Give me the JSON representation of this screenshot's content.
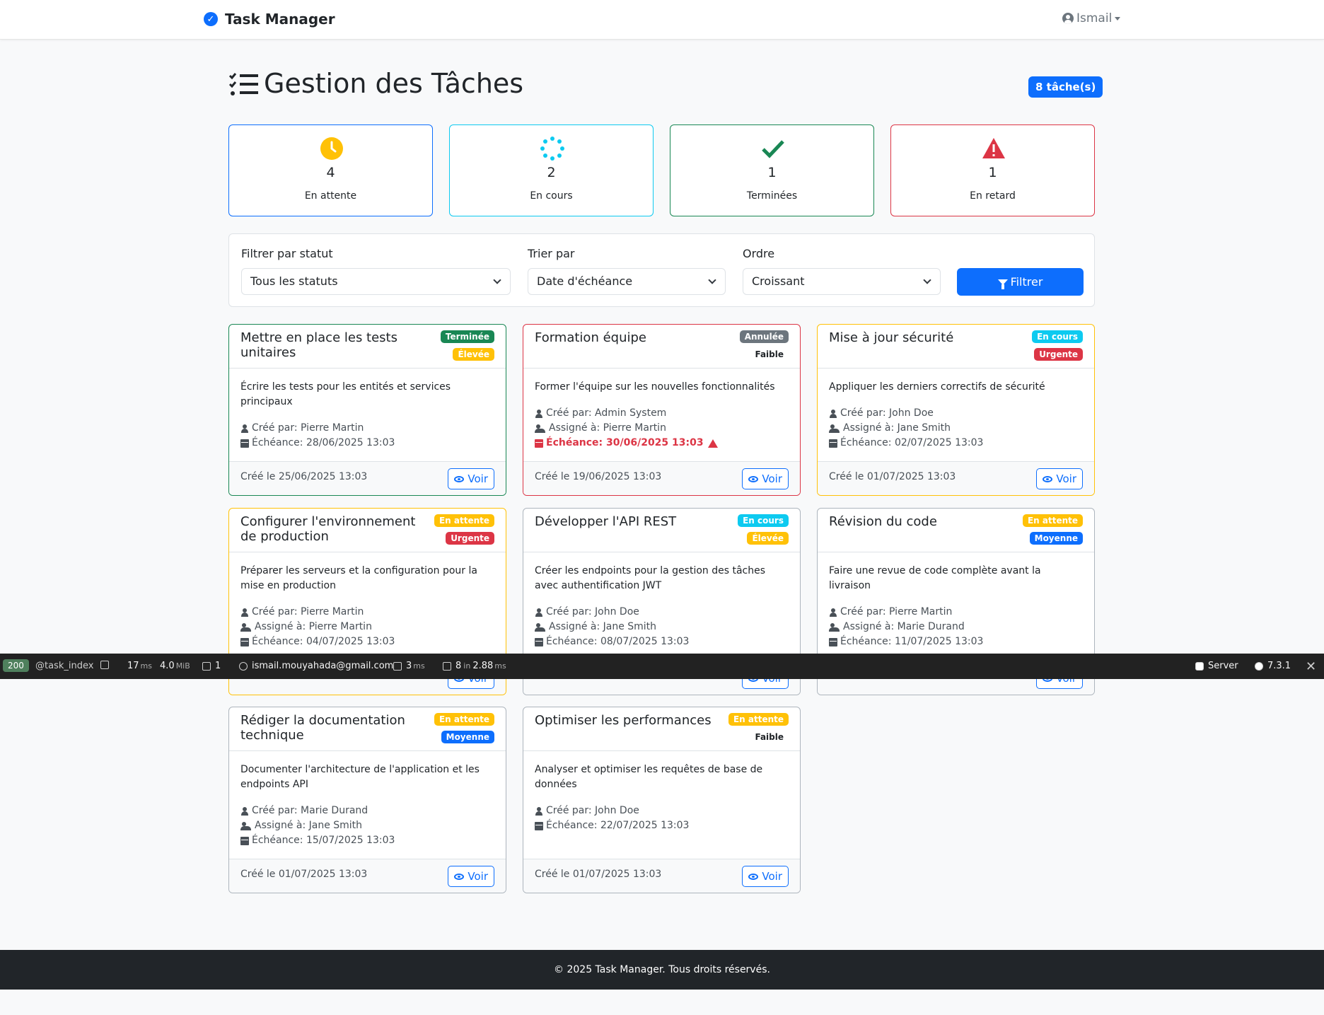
{
  "navbar": {
    "brand": "Task Manager",
    "user": "Ismail"
  },
  "header": {
    "title": "Gestion des Tâches",
    "count_badge": "8 tâche(s)"
  },
  "stats": [
    {
      "value": "4",
      "label": "En attente",
      "color": "#0d6efd",
      "icon": "clock-icon",
      "icon_color": "#ffc107"
    },
    {
      "value": "2",
      "label": "En cours",
      "color": "#0dcaf0",
      "icon": "spinner-icon",
      "icon_color": "#0dcaf0"
    },
    {
      "value": "1",
      "label": "Terminées",
      "color": "#198754",
      "icon": "check-icon",
      "icon_color": "#198754"
    },
    {
      "value": "1",
      "label": "En retard",
      "color": "#dc3545",
      "icon": "warning-icon",
      "icon_color": "#dc3545"
    }
  ],
  "filters": {
    "status_label": "Filtrer par statut",
    "status_value": "Tous les statuts",
    "sort_label": "Trier par",
    "sort_value": "Date d'échéance",
    "order_label": "Ordre",
    "order_value": "Croissant",
    "submit": "Filtrer"
  },
  "tasks": [
    {
      "title": "Mettre en place les tests unitaires",
      "status": "Terminée",
      "status_color": "#198754",
      "status_text_color": "#ffffff",
      "priority": "Élevée",
      "priority_color": "#ffc107",
      "priority_text_color": "#ffffff",
      "border_color": "#198754",
      "description": "Écrire les tests pour les entités et services principaux",
      "created_by": "Créé par: Pierre Martin",
      "assigned_to": "",
      "due": "Échéance: 28/06/2025 13:03",
      "created_at": "Créé le 25/06/2025 13:03",
      "action": "Voir"
    },
    {
      "title": "Formation équipe",
      "status": "Annulée",
      "status_color": "#6c757d",
      "status_text_color": "#ffffff",
      "priority": "Faible",
      "priority_color": "transparent",
      "priority_text_color": "#212529",
      "border_color": "#dc3545",
      "description": "Former l'équipe sur les nouvelles fonctionnalités",
      "created_by": "Créé par: Admin System",
      "assigned_to": "Assigné à: Pierre Martin",
      "due": "Échéance: 30/06/2025 13:03",
      "overdue": true,
      "created_at": "Créé le 19/06/2025 13:03",
      "action": "Voir"
    },
    {
      "title": "Mise à jour sécurité",
      "status": "En cours",
      "status_color": "#0dcaf0",
      "status_text_color": "#ffffff",
      "priority": "Urgente",
      "priority_color": "#dc3545",
      "priority_text_color": "#ffffff",
      "border_color": "#ffc107",
      "description": "Appliquer les derniers correctifs de sécurité",
      "created_by": "Créé par: John Doe",
      "assigned_to": "Assigné à: Jane Smith",
      "due": "Échéance: 02/07/2025 13:03",
      "created_at": "Créé le 01/07/2025 13:03",
      "action": "Voir"
    },
    {
      "title": "Configurer l'environnement de production",
      "status": "En attente",
      "status_color": "#ffc107",
      "status_text_color": "#ffffff",
      "priority": "Urgente",
      "priority_color": "#dc3545",
      "priority_text_color": "#ffffff",
      "border_color": "#ffc107",
      "description": "Préparer les serveurs et la configuration pour la mise en production",
      "created_by": "Créé par: Pierre Martin",
      "assigned_to": "Assigné à: Pierre Martin",
      "due": "Échéance: 04/07/2025 13:03",
      "created_at": "",
      "action": "Voir"
    },
    {
      "title": "Développer l'API REST",
      "status": "En cours",
      "status_color": "#0dcaf0",
      "status_text_color": "#ffffff",
      "priority": "Élevée",
      "priority_color": "#ffc107",
      "priority_text_color": "#ffffff",
      "border_color": "#adb5bd",
      "description": "Créer les endpoints pour la gestion des tâches avec authentification JWT",
      "created_by": "Créé par: John Doe",
      "assigned_to": "Assigné à: Jane Smith",
      "due": "Échéance: 08/07/2025 13:03",
      "created_at": "",
      "action": "Voir"
    },
    {
      "title": "Révision du code",
      "status": "En attente",
      "status_color": "#ffc107",
      "status_text_color": "#ffffff",
      "priority": "Moyenne",
      "priority_color": "#0d6efd",
      "priority_text_color": "#ffffff",
      "border_color": "#adb5bd",
      "description": "Faire une revue de code complète avant la livraison",
      "created_by": "Créé par: Pierre Martin",
      "assigned_to": "Assigné à: Marie Durand",
      "due": "Échéance: 11/07/2025 13:03",
      "created_at": "",
      "action": "Voir"
    },
    {
      "title": "Rédiger la documentation technique",
      "status": "En attente",
      "status_color": "#ffc107",
      "status_text_color": "#ffffff",
      "priority": "Moyenne",
      "priority_color": "#0d6efd",
      "priority_text_color": "#ffffff",
      "border_color": "#adb5bd",
      "description": "Documenter l'architecture de l'application et les endpoints API",
      "created_by": "Créé par: Marie Durand",
      "assigned_to": "Assigné à: Jane Smith",
      "due": "Échéance: 15/07/2025 13:03",
      "created_at": "Créé le 01/07/2025 13:03",
      "action": "Voir"
    },
    {
      "title": "Optimiser les performances",
      "status": "En attente",
      "status_color": "#ffc107",
      "status_text_color": "#ffffff",
      "priority": "Faible",
      "priority_color": "transparent",
      "priority_text_color": "#212529",
      "border_color": "#adb5bd",
      "description": "Analyser et optimiser les requêtes de base de données",
      "created_by": "Créé par: John Doe",
      "assigned_to": "",
      "due": "Échéance: 22/07/2025 13:03",
      "created_at": "Créé le 01/07/2025 13:03",
      "action": "Voir"
    }
  ],
  "debug_toolbar": {
    "status": "200",
    "route": "@task_index",
    "time": "17",
    "time_unit": "ms",
    "memory": "4.0",
    "memory_unit": "MiB",
    "twig": "1",
    "user": "ismail.mouyahada@gmail.com",
    "events": "3",
    "events_unit": "ms",
    "db": "8",
    "db_in": "in",
    "db_time": "2.88",
    "db_unit": "ms",
    "server": "Server",
    "version": "7.3.1"
  },
  "footer": {
    "text": "© 2025 Task Manager. Tous droits réservés."
  }
}
